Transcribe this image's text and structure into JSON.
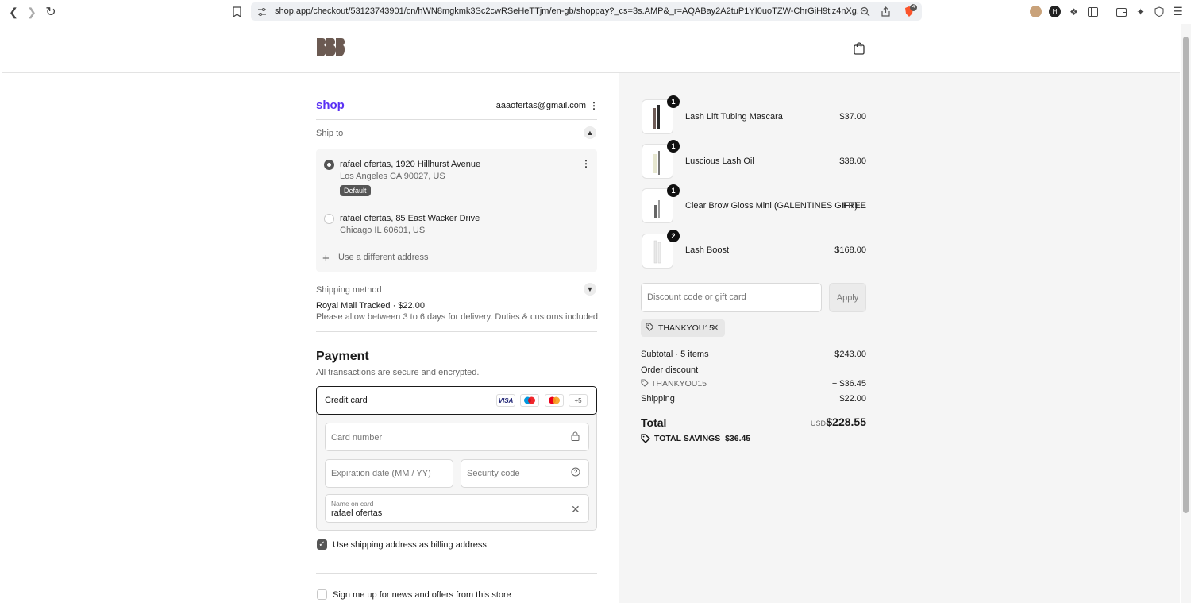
{
  "browser": {
    "url": "shop.app/checkout/53123743901/cn/hWN8mgkmk3Sc2cwRSeHeTTjm/en-gb/shoppay?_cs=3s.AMP&_r=AQABay2A2tuP1YI0uoTZW-ChrGiH9tiz4nXg...",
    "shield_count": "4"
  },
  "header": {
    "brand_logo_text": "BBB"
  },
  "account": {
    "shop_logo": "shop",
    "email": "aaaofertas@gmail.com"
  },
  "ship_to": {
    "label": "Ship to",
    "addresses": [
      {
        "line1": "rafael ofertas, 1920 Hillhurst Avenue",
        "line2": "Los Angeles CA 90027, US",
        "badge": "Default",
        "selected": true
      },
      {
        "line1": "rafael ofertas, 85 East Wacker Drive",
        "line2": "Chicago IL 60601, US",
        "selected": false
      }
    ],
    "add_new": "Use a different address"
  },
  "shipping_method": {
    "label": "Shipping method",
    "name": "Royal Mail Tracked · $22.00",
    "note": "Please allow between 3 to 6 days for delivery. Duties & customs included."
  },
  "payment": {
    "title": "Payment",
    "subtitle": "All transactions are secure and encrypted.",
    "method": "Credit card",
    "card_brands": [
      "VISA",
      "Maestro",
      "Mastercard",
      "+5"
    ],
    "card_number_placeholder": "Card number",
    "expiry_placeholder": "Expiration date (MM / YY)",
    "security_placeholder": "Security code",
    "name_label": "Name on card",
    "name_value": "rafael ofertas",
    "billing_same": "Use shipping address as billing address",
    "newsletter": "Sign me up for news and offers from this store"
  },
  "order": {
    "items": [
      {
        "name": "Lash Lift Tubing Mascara",
        "qty": "1",
        "price": "$37.00"
      },
      {
        "name": "Luscious Lash Oil",
        "qty": "1",
        "price": "$38.00"
      },
      {
        "name": "Clear Brow Gloss Mini (GALENTINES GIFT)",
        "qty": "1",
        "price": "FREE"
      },
      {
        "name": "Lash Boost",
        "qty": "2",
        "price": "$168.00"
      }
    ],
    "discount_placeholder": "Discount code or gift card",
    "apply_label": "Apply",
    "applied_code": "THANKYOU15",
    "subtotal_label": "Subtotal · 5 items",
    "subtotal_value": "$243.00",
    "order_discount_label": "Order discount",
    "discount_code": "THANKYOU15",
    "discount_value": "− $36.45",
    "shipping_label": "Shipping",
    "shipping_value": "$22.00",
    "total_label": "Total",
    "total_currency": "USD",
    "total_value": "$228.55",
    "savings": "TOTAL SAVINGS  $36.45"
  }
}
